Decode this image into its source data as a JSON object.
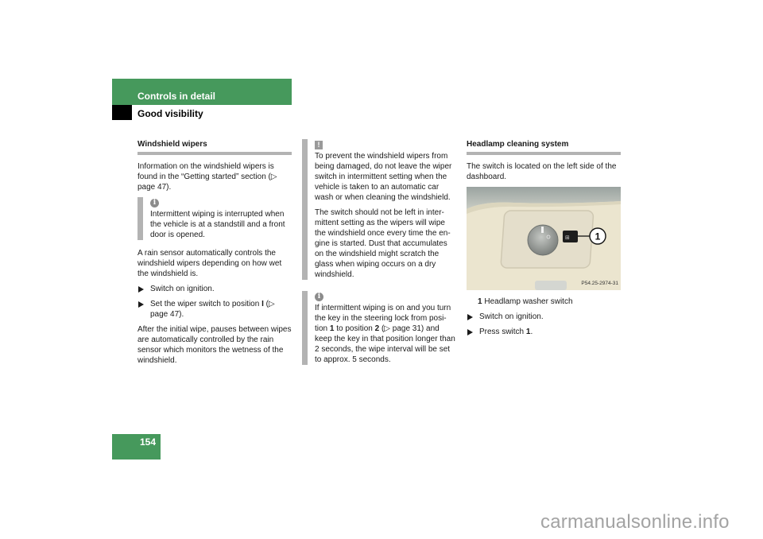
{
  "header": {
    "title": "Controls in detail",
    "subtitle": "Good visibility"
  },
  "page_number": "154",
  "colors": {
    "brand_green": "#46995c",
    "rule_gray": "#b3b3b3"
  },
  "column1": {
    "heading": "Windshield wipers",
    "intro": "Information on the windshield wipers is found in the “Getting started” section (▷ page 47).",
    "note": {
      "icon": "info-icon",
      "text": "Intermittent wiping is interrupted when the vehicle is at a standstill and a front door is opened."
    },
    "para2": "A rain sensor automatically controls the windshield wipers depending on how wet the windshield is.",
    "steps": [
      {
        "text": "Switch on ignition."
      },
      {
        "text_before": "Set the wiper switch to position ",
        "bold": "I",
        "text_after": " (▷ page 47)."
      }
    ],
    "para3": "After the initial wipe, pauses between wipes are automatically controlled by the rain sensor which monitors the wetness of the windshield."
  },
  "column2": {
    "warning": {
      "icon": "warning-icon",
      "paragraphs": [
        "To prevent the windshield wipers from being damaged, do not leave the wiper switch in intermittent setting when the vehicle is taken to an automatic car wash or when cleaning the windshield.",
        "The switch should not be left in inter-mittent setting as the wipers will wipe the windshield once every time the en-gine is started. Dust that accumulates on the windshield might scratch the glass when wiping occurs on a dry windshield."
      ]
    },
    "note": {
      "icon": "info-icon",
      "t1": "If intermittent wiping is on and you turn the key in the steering lock from posi-tion ",
      "b1": "1",
      "t2": " to position ",
      "b2": "2",
      "t3": " (▷ page 31) and keep the key in that position longer than 2 seconds, the wipe interval will be set to approx. 5 seconds."
    }
  },
  "column3": {
    "heading": "Headlamp cleaning system",
    "intro": "The switch is located on the left side of the dashboard.",
    "photo": {
      "callout": "1",
      "code": "P54.25-2974-31"
    },
    "legend": {
      "num": "1",
      "label": "Headlamp washer switch"
    },
    "steps": [
      {
        "text": "Switch on ignition."
      },
      {
        "text_before": "Press switch ",
        "bold": "1",
        "text_after": "."
      }
    ]
  },
  "watermark": "carmanualsonline.info"
}
